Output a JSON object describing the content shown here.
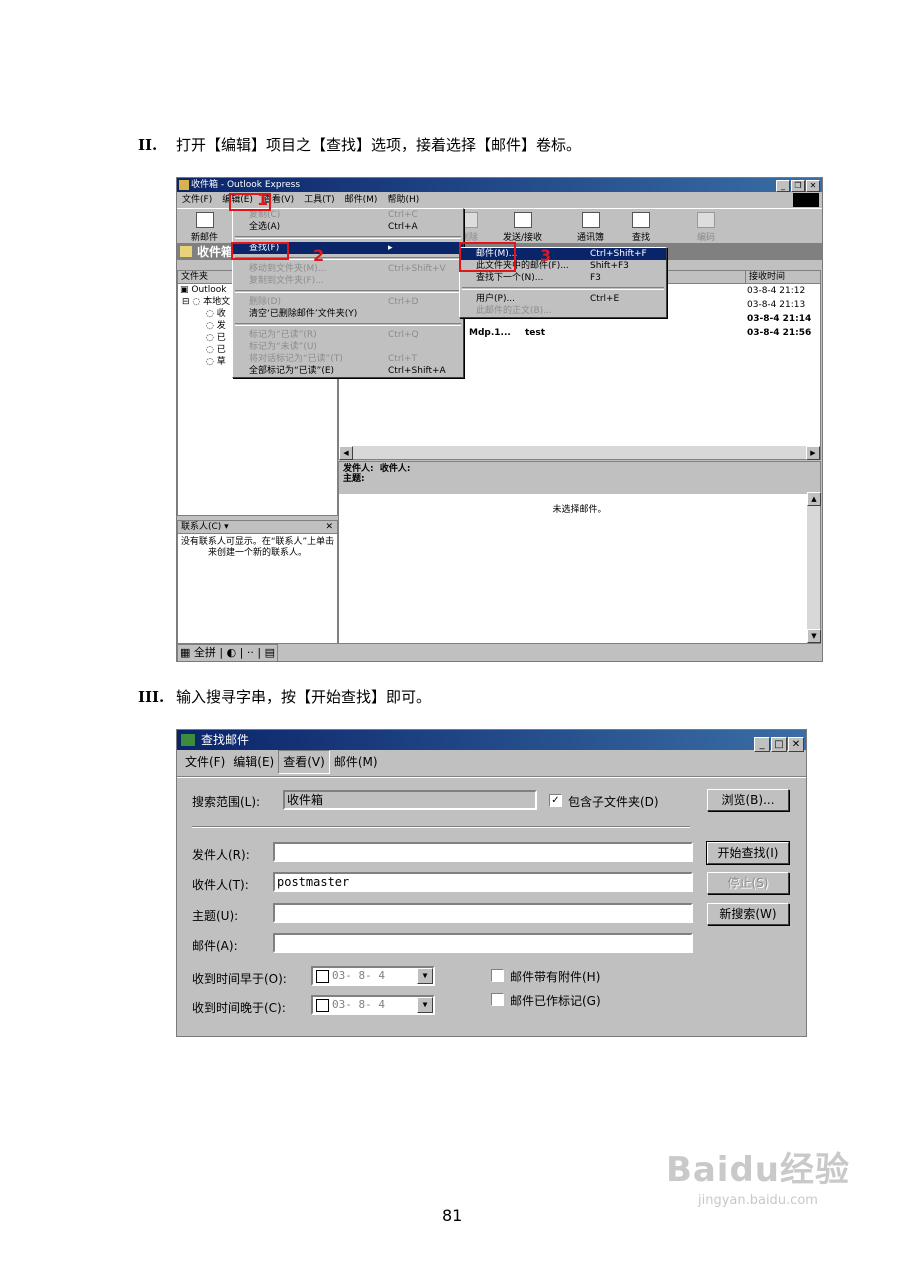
{
  "steps": [
    {
      "num": "II.",
      "text": "打开【编辑】项目之【查找】选项，接着选择【邮件】卷标。"
    },
    {
      "num": "III.",
      "text": "输入搜寻字串，按【开始查找】即可。"
    }
  ],
  "page_number": "81",
  "oe": {
    "title": "收件箱 - Outlook Express",
    "menu": [
      "文件(F)",
      "编辑(E)",
      "查看(V)",
      "工具(T)",
      "邮件(M)",
      "帮助(H)"
    ],
    "toolbar": {
      "new_mail": "新邮件",
      "delete": "删除",
      "send_receive": "发送/接收",
      "address_book": "通讯簿",
      "find": "查找",
      "encoding": "编码"
    },
    "folder_header": "收件箱",
    "folders_label": "文件夹",
    "tree": [
      "Outlook",
      "本地文",
      "收",
      "发",
      "已",
      "已",
      "草"
    ],
    "column_received": "接收时间",
    "messages": [
      {
        "from": "",
        "subject": "",
        "date": "03-8-4 21:12",
        "bold": false
      },
      {
        "from": "",
        "subject": "",
        "date": "03-8-4 21:13",
        "bold": false
      },
      {
        "from": "",
        "subject": "",
        "date": "03-8-4 21:14",
        "bold": true
      },
      {
        "from": "Mdp.1...",
        "subject": "test",
        "date": "03-8-4 21:56",
        "bold": true
      }
    ],
    "preview": {
      "from_label": "发件人:",
      "to_label": "收件人:",
      "subject_label": "主题:",
      "empty": "未选择邮件。"
    },
    "contacts": {
      "title": "联系人(C) ▾",
      "close": "✕",
      "text": "没有联系人可显示。在“联系人”上单击来创建一个新的联系人。"
    },
    "statusbar": "全拼",
    "edit_menu": [
      {
        "label": "复制(C)",
        "shortcut": "Ctrl+C",
        "disabled": true
      },
      {
        "label": "全选(A)",
        "shortcut": "Ctrl+A",
        "disabled": false
      },
      {
        "sep": true
      },
      {
        "label": "查找(F)",
        "shortcut": "▸",
        "selected": true
      },
      {
        "sep": true
      },
      {
        "label": "移动到文件夹(M)...",
        "shortcut": "Ctrl+Shift+V",
        "disabled": true
      },
      {
        "label": "复制到文件夹(F)...",
        "shortcut": "",
        "disabled": true
      },
      {
        "sep": true
      },
      {
        "label": "删除(D)",
        "shortcut": "Ctrl+D",
        "disabled": true
      },
      {
        "label": "清空‘已删除邮件’文件夹(Y)",
        "shortcut": "",
        "disabled": false
      },
      {
        "sep": true
      },
      {
        "label": "标记为“已读”(R)",
        "shortcut": "Ctrl+Q",
        "disabled": true
      },
      {
        "label": "标记为“未读”(U)",
        "shortcut": "",
        "disabled": true
      },
      {
        "label": "将对话标记为“已读”(T)",
        "shortcut": "Ctrl+T",
        "disabled": true
      },
      {
        "label": "全部标记为“已读”(E)",
        "shortcut": "Ctrl+Shift+A",
        "disabled": false
      }
    ],
    "find_submenu": [
      {
        "label": "邮件(M)...",
        "shortcut": "Ctrl+Shift+F",
        "selected": true
      },
      {
        "label": "此文件夹中的邮件(F)...",
        "shortcut": "Shift+F3",
        "disabled": false
      },
      {
        "label": "查找下一个(N)...",
        "shortcut": "F3",
        "disabled": false
      },
      {
        "sep": true
      },
      {
        "label": "用户(P)...",
        "shortcut": "Ctrl+E",
        "disabled": false
      },
      {
        "label": "此邮件的正文(B)...",
        "shortcut": "",
        "disabled": true
      }
    ],
    "markers": [
      "1",
      "2",
      "3"
    ],
    "colors": {
      "annotation_red": "#e0161b",
      "title_bar": "#0a246a",
      "selection": "#0a246a"
    }
  },
  "find_dialog": {
    "title": "查找邮件",
    "menu": [
      "文件(F)",
      "编辑(E)",
      "查看(V)",
      "邮件(M)"
    ],
    "search_in_label": "搜索范围(L):",
    "search_in_value": "收件箱",
    "include_subfolders": "包含子文件夹(D)",
    "include_subfolders_checked": "✓",
    "browse": "浏览(B)...",
    "from_label": "发件人(R):",
    "from_value": "",
    "to_label": "收件人(T):",
    "to_value": "postmaster",
    "subject_label": "主题(U):",
    "subject_value": "",
    "message_label": "邮件(A):",
    "message_value": "",
    "find_now": "开始查找(I)",
    "stop": "停止(S)",
    "new_search": "新搜索(W)",
    "received_before_label": "收到时间早于(O):",
    "received_before_value": "03- 8- 4",
    "received_after_label": "收到时间晚于(C):",
    "received_after_value": "03- 8- 4",
    "has_attachment": "邮件带有附件(H)",
    "flagged": "邮件已作标记(G)"
  },
  "watermark": {
    "brand": "Baidu经验",
    "url": "jingyan.baidu.com"
  }
}
